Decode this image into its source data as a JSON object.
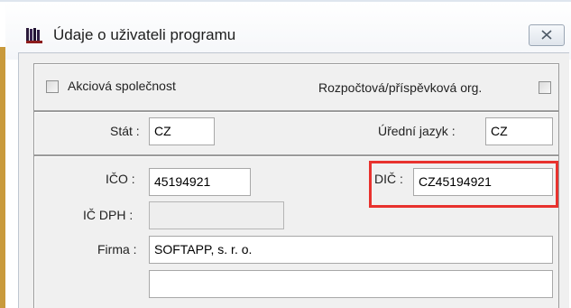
{
  "window": {
    "title": "Údaje o uživateli programu",
    "app_icon": "books-icon",
    "close_icon": "close-icon"
  },
  "flags": {
    "akciova_label": "Akciová společnost",
    "akciova_checked": false,
    "rozpoctova_label": "Rozpočtová/příspěvková org.",
    "rozpoctova_checked": false
  },
  "locale": {
    "stat_label": "Stát :",
    "stat_value": "CZ",
    "jazyk_label": "Úřední jazyk :",
    "jazyk_value": "CZ"
  },
  "company": {
    "ico_label": "IČO :",
    "ico_value": "45194921",
    "dic_label": "DIČ :",
    "dic_value": "CZ45194921",
    "ic_dph_label": "IČ DPH :",
    "ic_dph_value": "",
    "firma_label": "Firma :",
    "firma_value": "SOFTAPP, s. r. o.",
    "firma_line2_value": ""
  },
  "colors": {
    "highlight": "#e8322e",
    "window_accent": "#c99a3c",
    "panel_bg": "#f0f0f0"
  }
}
